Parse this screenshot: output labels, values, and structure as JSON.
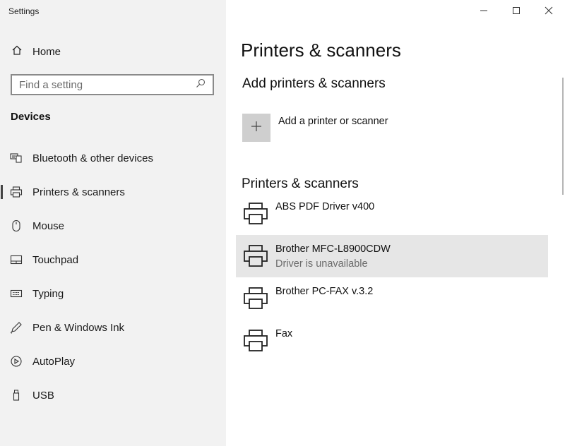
{
  "window": {
    "title": "Settings",
    "controls": [
      "minimize-icon",
      "maximize-icon",
      "close-icon"
    ]
  },
  "sidebar": {
    "home_label": "Home",
    "search": {
      "placeholder": "Find a setting",
      "value": ""
    },
    "section": "Devices",
    "items": [
      {
        "label": "Bluetooth & other devices",
        "icon": "bluetooth-devices-icon",
        "selected": false
      },
      {
        "label": "Printers & scanners",
        "icon": "printer-icon",
        "selected": true
      },
      {
        "label": "Mouse",
        "icon": "mouse-icon",
        "selected": false
      },
      {
        "label": "Touchpad",
        "icon": "touchpad-icon",
        "selected": false
      },
      {
        "label": "Typing",
        "icon": "keyboard-icon",
        "selected": false
      },
      {
        "label": "Pen & Windows Ink",
        "icon": "pen-icon",
        "selected": false
      },
      {
        "label": "AutoPlay",
        "icon": "autoplay-icon",
        "selected": false
      },
      {
        "label": "USB",
        "icon": "usb-icon",
        "selected": false
      }
    ]
  },
  "main": {
    "title": "Printers & scanners",
    "add_section_heading": "Add printers & scanners",
    "add_button_label": "Add a printer or scanner",
    "list_heading": "Printers & scanners",
    "printers": [
      {
        "name": "ABS PDF Driver v400",
        "status": ""
      },
      {
        "name": "Brother MFC-L8900CDW",
        "status": "Driver is unavailable",
        "highlighted": true
      },
      {
        "name": "Brother PC-FAX v.3.2",
        "status": ""
      },
      {
        "name": "Fax",
        "status": ""
      }
    ]
  },
  "colors": {
    "sidebar_bg": "#f2f2f2",
    "highlight_bg": "#e6e6e6",
    "add_tile_bg": "#cfcfcf",
    "secondary_text": "#6b6b6b"
  }
}
